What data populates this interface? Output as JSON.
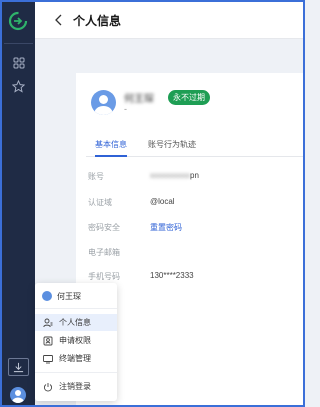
{
  "header": {
    "title": "个人信息"
  },
  "profile": {
    "name": "何王琛",
    "subtitle": "-",
    "badge": "永不过期"
  },
  "tabs": [
    {
      "label": "基本信息",
      "active": true
    },
    {
      "label": "账号行为轨迹",
      "active": false
    }
  ],
  "fields": [
    {
      "label": "账号",
      "value": "pn"
    },
    {
      "label": "认证域",
      "value": "@local"
    },
    {
      "label": "密码安全",
      "value": "重置密码"
    },
    {
      "label": "电子邮箱",
      "value": ""
    },
    {
      "label": "手机号码",
      "value": "130****2333"
    }
  ],
  "menu": {
    "user_name": "何王琛",
    "items": [
      {
        "label": "个人信息",
        "icon": "user-profile-icon",
        "selected": true
      },
      {
        "label": "申请权限",
        "icon": "permission-apply-icon",
        "selected": false
      },
      {
        "label": "终端管理",
        "icon": "terminal-icon",
        "selected": false
      },
      {
        "label": "注销登录",
        "icon": "power-icon",
        "selected": false
      }
    ]
  },
  "colors": {
    "sidebar": "#1f2b45",
    "accent": "#2f62d6",
    "badge": "#1e9e54",
    "logo": "#2fb36b"
  }
}
